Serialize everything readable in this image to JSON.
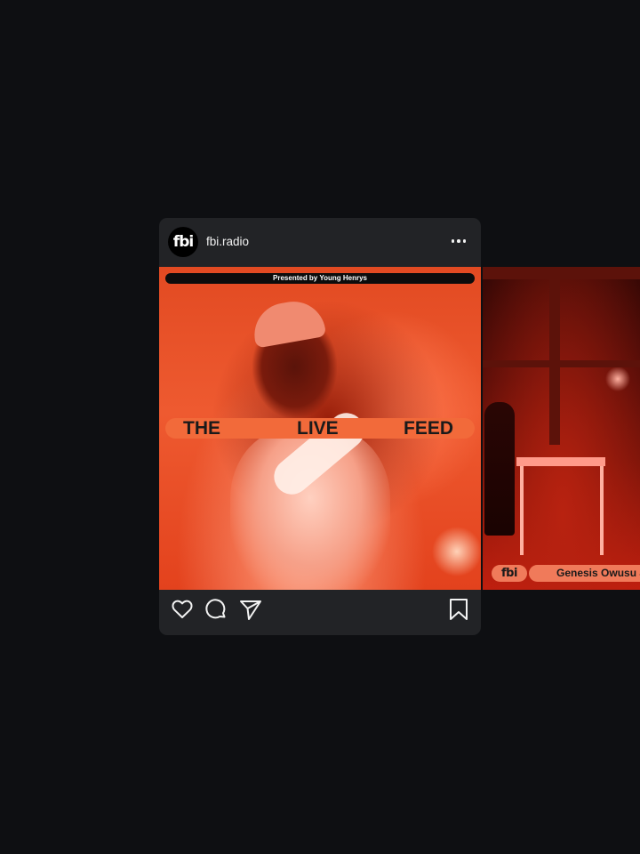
{
  "post": {
    "avatar_text": "fbi",
    "username": "fbi.radio",
    "more_icon": "more-horizontal-icon"
  },
  "slides": [
    {
      "presented_by": "Presented by Young Henrys",
      "title_words": [
        "THE",
        "LIVE",
        "FEED"
      ]
    },
    {
      "logo_text": "fbi",
      "caption": "Genesis Owusu a"
    }
  ],
  "actions": {
    "icons": [
      "heart-icon",
      "comment-icon",
      "share-icon",
      "bookmark-icon"
    ]
  },
  "colors": {
    "page_bg": "#0e0f12",
    "card_bg": "#222326",
    "accent_orange": "#f26a3a",
    "photo_red": "#e24a22"
  }
}
